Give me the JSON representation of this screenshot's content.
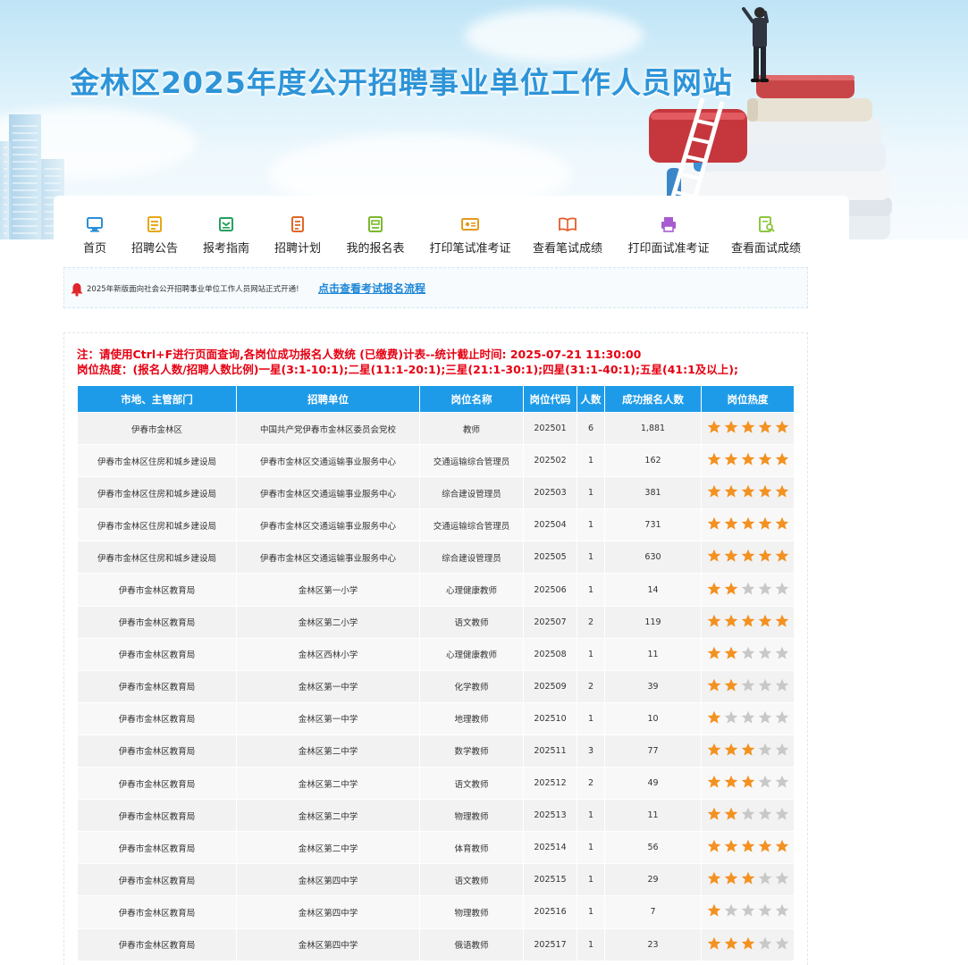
{
  "header": {
    "site_title": "金林区2025年度公开招聘事业单位工作人员网站"
  },
  "nav": {
    "items": [
      {
        "label": "首页",
        "icon": "monitor-icon"
      },
      {
        "label": "招聘公告",
        "icon": "announcement-icon"
      },
      {
        "label": "报考指南",
        "icon": "guide-icon"
      },
      {
        "label": "招聘计划",
        "icon": "plan-icon"
      },
      {
        "label": "我的报名表",
        "icon": "form-icon"
      },
      {
        "label": "打印笔试准考证",
        "icon": "ticket-icon"
      },
      {
        "label": "查看笔试成绩",
        "icon": "book-icon"
      },
      {
        "label": "打印面试准考证",
        "icon": "printer-icon"
      },
      {
        "label": "查看面试成绩",
        "icon": "search-doc-icon"
      }
    ]
  },
  "notice": {
    "text": "2025年新版面向社会公开招聘事业单位工作人员网站正式开通!",
    "link": "点击查看考试报名流程"
  },
  "notes": {
    "line1": "注：请使用Ctrl+F进行页面查询,各岗位成功报名人数统 (已缴费)计表--统计截止时间: 2025-07-21 11:30:00",
    "line2": "岗位热度：(报名人数/招聘人数比例)一星(3:1-10:1);二星(11:1-20:1);三星(21:1-30:1);四星(31:1-40:1);五星(41:1及以上);"
  },
  "table": {
    "headers": [
      "市地、主管部门",
      "招聘单位",
      "岗位名称",
      "岗位代码",
      "人数",
      "成功报名人数",
      "岗位热度"
    ],
    "rows": [
      {
        "dept": "伊春市金林区",
        "unit": "中国共产党伊春市金林区委员会党校",
        "position": "教师",
        "code": "202501",
        "count": "6",
        "applicants": "1,881",
        "stars": 5
      },
      {
        "dept": "伊春市金林区住房和城乡建设局",
        "unit": "伊春市金林区交通运输事业服务中心",
        "position": "交通运输综合管理员",
        "code": "202502",
        "count": "1",
        "applicants": "162",
        "stars": 5
      },
      {
        "dept": "伊春市金林区住房和城乡建设局",
        "unit": "伊春市金林区交通运输事业服务中心",
        "position": "综合建设管理员",
        "code": "202503",
        "count": "1",
        "applicants": "381",
        "stars": 5
      },
      {
        "dept": "伊春市金林区住房和城乡建设局",
        "unit": "伊春市金林区交通运输事业服务中心",
        "position": "交通运输综合管理员",
        "code": "202504",
        "count": "1",
        "applicants": "731",
        "stars": 5
      },
      {
        "dept": "伊春市金林区住房和城乡建设局",
        "unit": "伊春市金林区交通运输事业服务中心",
        "position": "综合建设管理员",
        "code": "202505",
        "count": "1",
        "applicants": "630",
        "stars": 5
      },
      {
        "dept": "伊春市金林区教育局",
        "unit": "金林区第一小学",
        "position": "心理健康教师",
        "code": "202506",
        "count": "1",
        "applicants": "14",
        "stars": 2
      },
      {
        "dept": "伊春市金林区教育局",
        "unit": "金林区第二小学",
        "position": "语文教师",
        "code": "202507",
        "count": "2",
        "applicants": "119",
        "stars": 5
      },
      {
        "dept": "伊春市金林区教育局",
        "unit": "金林区西林小学",
        "position": "心理健康教师",
        "code": "202508",
        "count": "1",
        "applicants": "11",
        "stars": 2
      },
      {
        "dept": "伊春市金林区教育局",
        "unit": "金林区第一中学",
        "position": "化学教师",
        "code": "202509",
        "count": "2",
        "applicants": "39",
        "stars": 2
      },
      {
        "dept": "伊春市金林区教育局",
        "unit": "金林区第一中学",
        "position": "地理教师",
        "code": "202510",
        "count": "1",
        "applicants": "10",
        "stars": 1
      },
      {
        "dept": "伊春市金林区教育局",
        "unit": "金林区第二中学",
        "position": "数学教师",
        "code": "202511",
        "count": "3",
        "applicants": "77",
        "stars": 3
      },
      {
        "dept": "伊春市金林区教育局",
        "unit": "金林区第二中学",
        "position": "语文教师",
        "code": "202512",
        "count": "2",
        "applicants": "49",
        "stars": 3
      },
      {
        "dept": "伊春市金林区教育局",
        "unit": "金林区第二中学",
        "position": "物理教师",
        "code": "202513",
        "count": "1",
        "applicants": "11",
        "stars": 2
      },
      {
        "dept": "伊春市金林区教育局",
        "unit": "金林区第二中学",
        "position": "体育教师",
        "code": "202514",
        "count": "1",
        "applicants": "56",
        "stars": 5
      },
      {
        "dept": "伊春市金林区教育局",
        "unit": "金林区第四中学",
        "position": "语文教师",
        "code": "202515",
        "count": "1",
        "applicants": "29",
        "stars": 3
      },
      {
        "dept": "伊春市金林区教育局",
        "unit": "金林区第四中学",
        "position": "物理教师",
        "code": "202516",
        "count": "1",
        "applicants": "7",
        "stars": 1
      },
      {
        "dept": "伊春市金林区教育局",
        "unit": "金林区第四中学",
        "position": "俄语教师",
        "code": "202517",
        "count": "1",
        "applicants": "23",
        "stars": 3
      }
    ]
  },
  "colors": {
    "title_blue": "#2d94d8",
    "header_blue": "#1e9be8",
    "note_red": "#e60012",
    "star_on": "#f39121",
    "star_off": "#c8c8c8"
  }
}
